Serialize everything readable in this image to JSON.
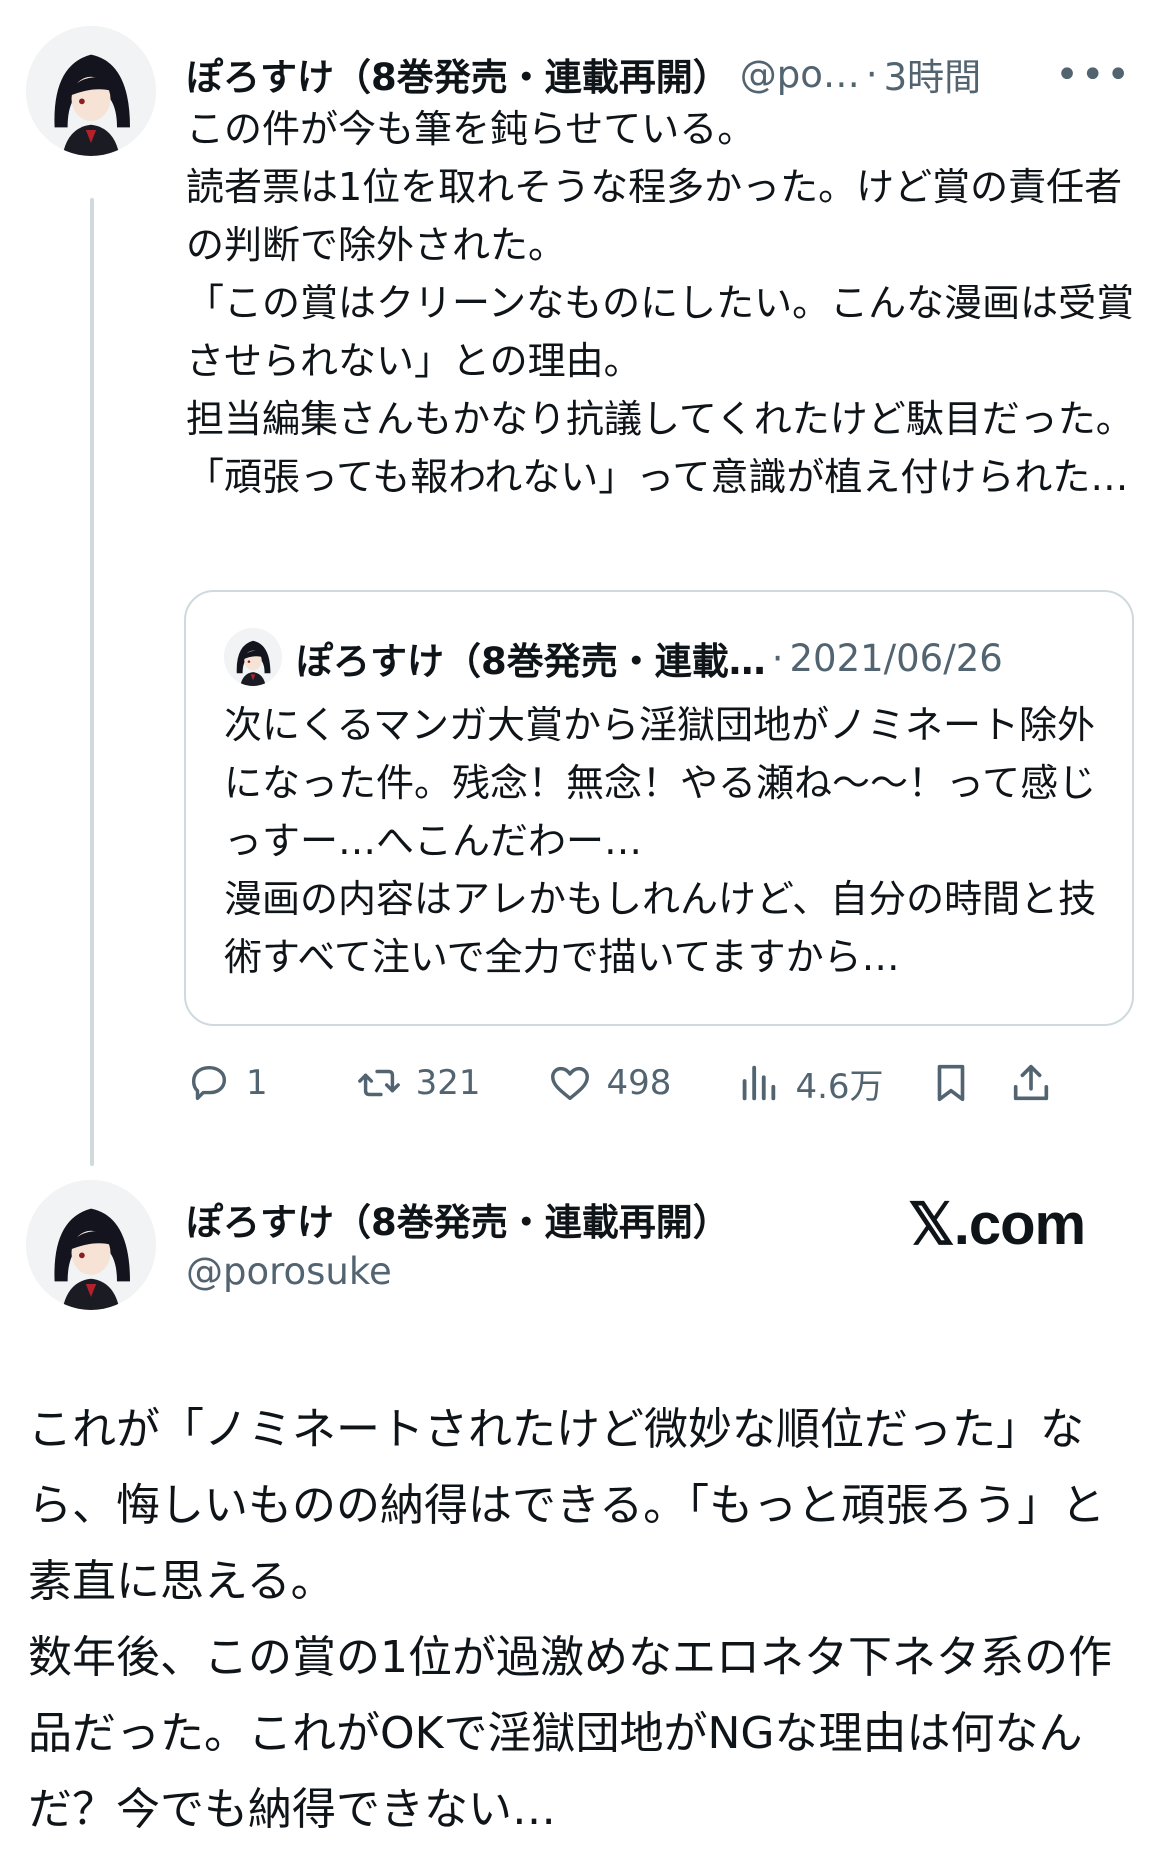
{
  "tweet1": {
    "author_name": "ぽろすけ（8巻発売・連載再開）",
    "handle": "@po…",
    "separator": "·",
    "time": "3時間",
    "more_icon": "more-horizontal-icon",
    "text": "この件が今も筆を鈍らせている。\n読者票は1位を取れそうな程多かった。けど賞の責任者の判断で除外された。\n「この賞はクリーンなものにしたい。こんな漫画は受賞させられない」との理由。\n担当編集さんもかなり抗議してくれたけど駄目だった。「頑張っても報われない」って意識が植え付けられた…"
  },
  "quote": {
    "author_name": "ぽろすけ（8巻発売・連載…",
    "separator": "·",
    "date": "2021/06/26",
    "text": "次にくるマンガ大賞から淫獄団地がノミネート除外になった件。残念！無念！やる瀬ね〜〜！って感じっすー…へこんだわー…\n漫画の内容はアレかもしれんけど、自分の時間と技術すべて注いで全力で描いてますから…"
  },
  "actions": {
    "reply": {
      "icon": "reply-icon",
      "count": "1"
    },
    "retweet": {
      "icon": "retweet-icon",
      "count": "321"
    },
    "like": {
      "icon": "heart-icon",
      "count": "498"
    },
    "views": {
      "icon": "views-icon",
      "count": "4.6万"
    },
    "bookmark": {
      "icon": "bookmark-icon"
    },
    "share": {
      "icon": "share-icon"
    }
  },
  "tweet2": {
    "author_name": "ぽろすけ（8巻発売・連載再開）",
    "handle": "@porosuke",
    "brand": "𝕏.com",
    "text": "これが「ノミネートされたけど微妙な順位だった」なら、悔しいものの納得はできる。「もっと頑張ろう」と素直に思える。\n数年後、この賞の1位が過激めなエロネタ下ネタ系の作品だった。これがOKで淫獄団地がNGな理由は何なんだ？今でも納得できない…"
  },
  "colors": {
    "text": "#0f1419",
    "muted": "#536471",
    "border": "#cfd9de"
  }
}
